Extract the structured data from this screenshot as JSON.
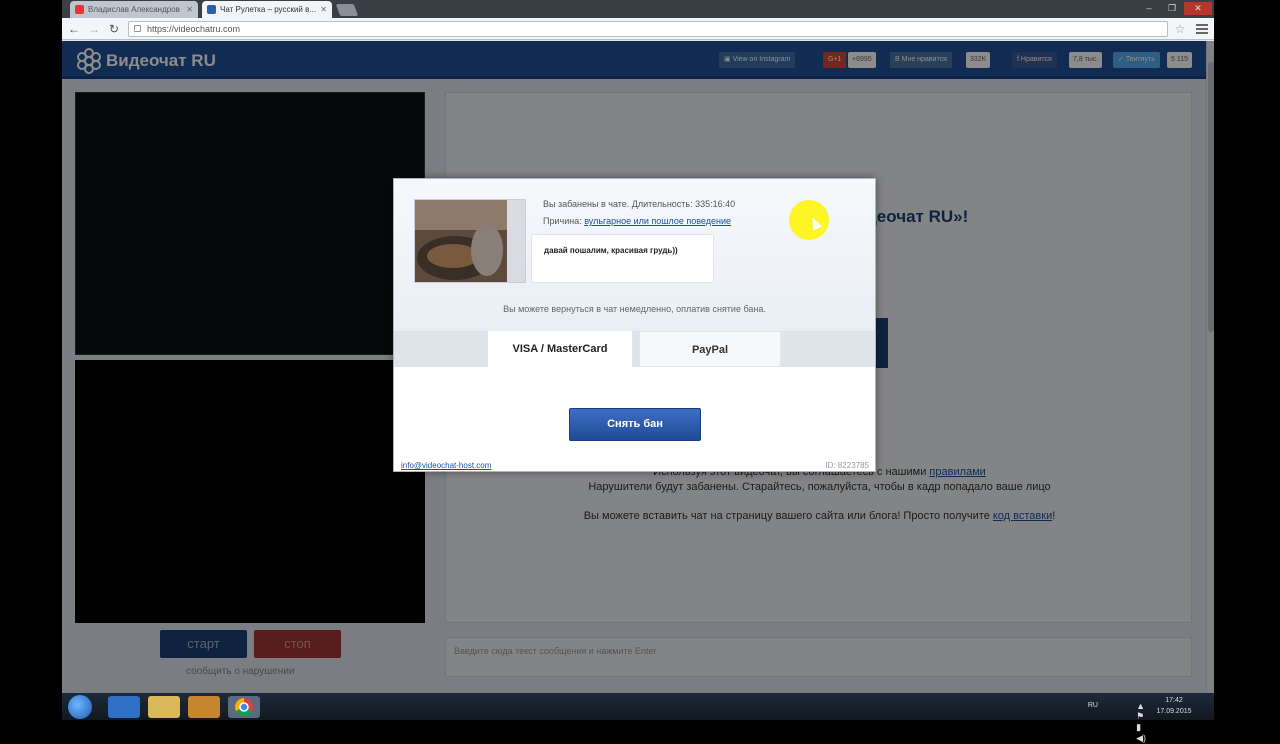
{
  "browser": {
    "tabs": [
      {
        "label": "Владислав Александров"
      },
      {
        "label": "Чат Рулетка – русский в..."
      }
    ],
    "url": "https://videochatru.com"
  },
  "site": {
    "title": "Видеочат RU",
    "social": {
      "instagram": "View on Instagram",
      "gplus": "G+1",
      "gplus_count": "+6995",
      "vk": "Мне нравится",
      "vk_count": "332K",
      "fb": "Нравится",
      "fb_count": "7,8 тыс.",
      "tw": "Твитнуть",
      "tw_count": "5 115"
    }
  },
  "controls": {
    "start": "старт",
    "stop": "стоп",
    "report": "сообщить о нарушении"
  },
  "main": {
    "welcome": "деочат RU»!",
    "rules_prefix": "Используя этот видеочат, вы соглашаетесь с нашими ",
    "rules_link": "правилами",
    "violators": "Нарушители будут забанены. Старайтесь, пожалуйста, чтобы в кадр попадало ваше лицо",
    "embed_prefix": "Вы можете вставить чат на страницу вашего сайта или блога! Просто получите ",
    "embed_link": "код вставки",
    "embed_suffix": "!",
    "input_placeholder": "Введите сюда текст сообщения и нажмите Enter"
  },
  "modal": {
    "ban_title": "Вы забанены в чате. Длительность: 335:16:40",
    "reason_label": "Причина: ",
    "reason_link": "вульгарное или пошлое поведение",
    "quote": "давай пошалим, красивая грудь))",
    "pay_info": "Вы можете вернуться в чат немедленно, оплатив снятие бана.",
    "tab_card": "VISA / MasterCard",
    "tab_paypal": "PayPal",
    "unban_button": "Снять бан",
    "email": "info@videochat-host.com",
    "user_id": "ID: 8223785"
  },
  "taskbar": {
    "lang": "RU",
    "time": "17:42",
    "date": "17.09.2015"
  },
  "colors": {
    "brand": "#1f4f97",
    "start": "#1c3f75",
    "stop": "#9e3434"
  }
}
